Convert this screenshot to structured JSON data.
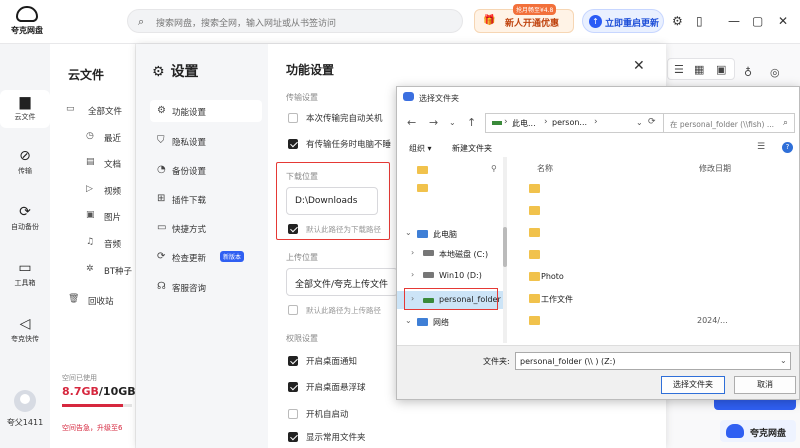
{
  "app": {
    "name": "夸克网盘"
  },
  "topbar": {
    "search_placeholder": "搜索网盘，搜索全网，输入网址或从书签访问",
    "promo_tag": "抢月畅至¥4.8",
    "promo_label": "新人开通优惠",
    "update_label": "立即重启更新",
    "icons": [
      "search-icon",
      "gift-icon",
      "settings-icon",
      "phone-icon",
      "minimize-icon",
      "maximize-icon",
      "close-icon"
    ]
  },
  "leftnav": {
    "items": [
      {
        "label": "云文件",
        "icon": "folder-icon"
      },
      {
        "label": "传输",
        "icon": "transfer-icon"
      },
      {
        "label": "自动备份",
        "icon": "sync-icon"
      },
      {
        "label": "工具箱",
        "icon": "toolbox-icon"
      },
      {
        "label": "夸克快传",
        "icon": "send-icon"
      }
    ],
    "user": "夸父1411"
  },
  "cloudpanel": {
    "title": "云文件",
    "items": [
      {
        "label": "全部文件",
        "icon": "folder-icon"
      },
      {
        "label": "最近",
        "icon": "clock-icon"
      },
      {
        "label": "文档",
        "icon": "doc-icon"
      },
      {
        "label": "视频",
        "icon": "video-icon"
      },
      {
        "label": "图片",
        "icon": "image-icon"
      },
      {
        "label": "音频",
        "icon": "audio-icon"
      },
      {
        "label": "BT种子",
        "icon": "bt-icon"
      },
      {
        "label": "回收站",
        "icon": "trash-icon"
      }
    ],
    "storage": {
      "label": "空间已使用",
      "used": "8.7GB",
      "sep": "/10GB",
      "used_fraction": 0.87,
      "warning": "空间告急，升级至6"
    }
  },
  "settings": {
    "title": "设置",
    "main_title": "功能设置",
    "menu": [
      {
        "label": "功能设置",
        "icon": "settings-icon",
        "active": true
      },
      {
        "label": "隐私设置",
        "icon": "shield-icon"
      },
      {
        "label": "备份设置",
        "icon": "backup-icon"
      },
      {
        "label": "插件下载",
        "icon": "plugin-icon"
      },
      {
        "label": "快捷方式",
        "icon": "shortcut-icon"
      },
      {
        "label": "检查更新",
        "icon": "update-icon",
        "badge": "新版本"
      },
      {
        "label": "客服咨询",
        "icon": "support-icon"
      }
    ],
    "sections": {
      "transfer": "传输设置",
      "download": "下载位置",
      "upload": "上传位置",
      "permission": "权限设置"
    },
    "options": {
      "auto_shutdown": "本次传输完自动关机",
      "no_sleep": "有传输任务时电脑不睡",
      "default_download": "默认此路径为下载路径",
      "default_upload": "默认此路径为上传路径",
      "desktop_notify": "开启桌面通知",
      "float_ball": "开启桌面悬浮球",
      "autostart": "开机自启动",
      "common_folder": "显示常用文件夹"
    },
    "download_path": "D:\\Downloads",
    "upload_path": "全部文件/夸克上传文件"
  },
  "chooser": {
    "title": "选择文件夹",
    "address": {
      "part1": "此电...",
      "part2": "person..."
    },
    "search_placeholder": "在 personal_folder (\\\\fish) ...",
    "toolbar": {
      "organize": "组织 ▾",
      "new_folder": "新建文件夹"
    },
    "tree": [
      {
        "label": "",
        "icon": "folder-icon"
      },
      {
        "label": "",
        "icon": "folder-icon"
      },
      {
        "label": "此电脑",
        "icon": "computer-icon"
      },
      {
        "label": "本地磁盘 (C:)",
        "icon": "drive-icon"
      },
      {
        "label": "Win10 (D:)",
        "icon": "drive-icon"
      },
      {
        "label": "personal_folder",
        "icon": "network-drive-icon"
      },
      {
        "label": "网络",
        "icon": "network-icon"
      }
    ],
    "columns": {
      "name": "名称",
      "date": "修改日期"
    },
    "files": [
      {
        "name": "",
        "date": ""
      },
      {
        "name": "",
        "date": ""
      },
      {
        "name": "",
        "date": ""
      },
      {
        "name": "",
        "date": ""
      },
      {
        "name": "Photo",
        "date": ""
      },
      {
        "name": "工作文件",
        "date": ""
      },
      {
        "name": "",
        "date": "2024/..."
      }
    ],
    "folder_label": "文件夹:",
    "folder_value": "personal_folder (\\\\      ) (Z:)",
    "select_button": "选择文件夹",
    "cancel_button": "取消"
  },
  "brand": {
    "label": "夸克网盘"
  }
}
